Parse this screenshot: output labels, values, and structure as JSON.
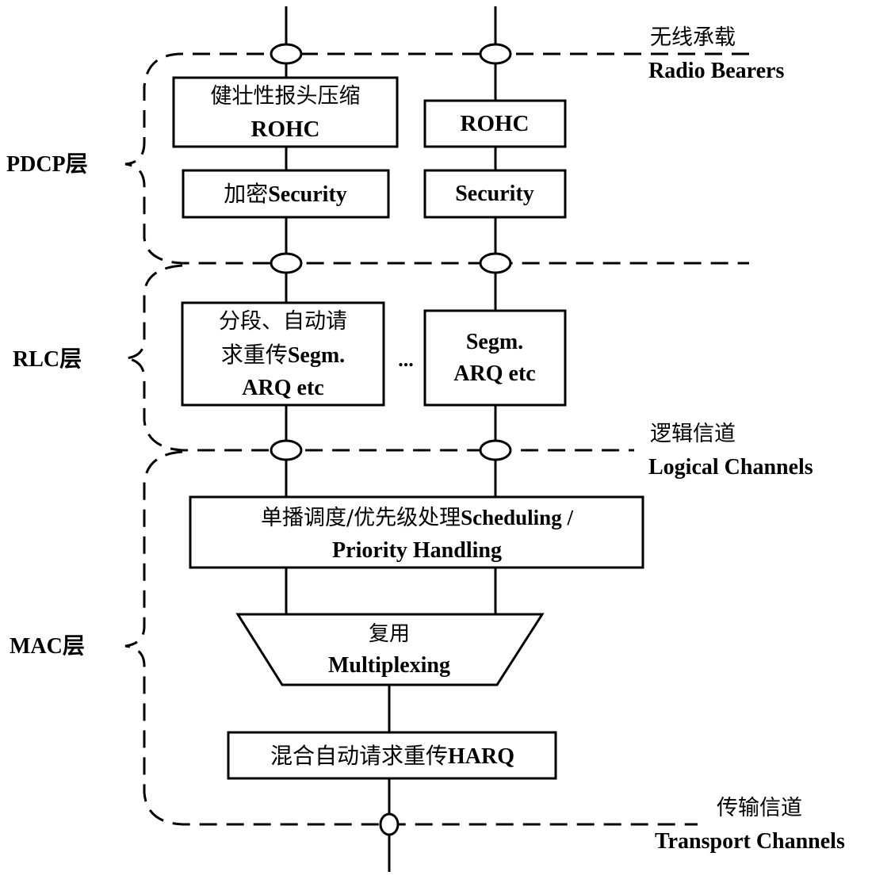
{
  "layers": [
    {
      "id": "pdcp",
      "label": "PDCP层"
    },
    {
      "id": "rlc",
      "label": "RLC层"
    },
    {
      "id": "mac",
      "label": "MAC层"
    }
  ],
  "channels": {
    "radio_bearers": {
      "cn": "无线承载",
      "en": "Radio Bearers"
    },
    "logical_channels": {
      "cn": "逻辑信道",
      "en": "Logical Channels"
    },
    "transport_channels": {
      "cn": "传输信道",
      "en": "Transport Channels"
    }
  },
  "pdcp": {
    "rohc_left": {
      "line1": "健壮性报头压缩",
      "line2": "ROHC"
    },
    "security_left": {
      "cn": "加密",
      "en": "Security"
    },
    "rohc_right": "ROHC",
    "security_right": "Security"
  },
  "rlc": {
    "left": {
      "line1": "分段、自动请",
      "line2_cn": "求重传",
      "line2_en": "Segm.",
      "line3": "ARQ etc"
    },
    "ellipsis": "...",
    "right": {
      "line1": "Segm.",
      "line2": "ARQ etc"
    }
  },
  "mac": {
    "scheduling": {
      "line1_cn": "单播调度/优先级处理",
      "line1_en": "Scheduling /",
      "line2": "Priority Handling"
    },
    "multiplexing": {
      "cn": "复用",
      "en": "Multiplexing"
    },
    "harq": {
      "cn": "混合自动请求重传",
      "en": "HARQ"
    }
  }
}
